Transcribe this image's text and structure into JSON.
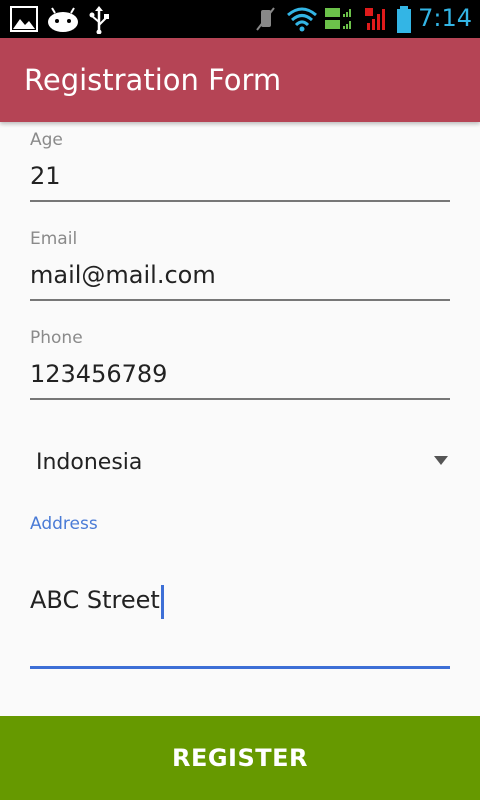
{
  "status_bar": {
    "time": "7:14",
    "icons": [
      "image-icon",
      "android-icon",
      "usb-icon",
      "mute-icon",
      "wifi-icon",
      "ev-signal-icon",
      "signal-bars-icon",
      "battery-icon"
    ],
    "time_color": "#33b5e5"
  },
  "app_bar": {
    "title": "Registration Form",
    "color": "#b54455"
  },
  "form": {
    "age": {
      "label": "Age",
      "value": "21"
    },
    "email": {
      "label": "Email",
      "value": "mail@mail.com"
    },
    "phone": {
      "label": "Phone",
      "value": "123456789"
    },
    "country": {
      "selected": "Indonesia"
    },
    "address": {
      "label": "Address",
      "value": "ABC Street",
      "accent": "#4a7bd6"
    }
  },
  "register_button": {
    "label": "REGISTER",
    "color": "#669900"
  }
}
